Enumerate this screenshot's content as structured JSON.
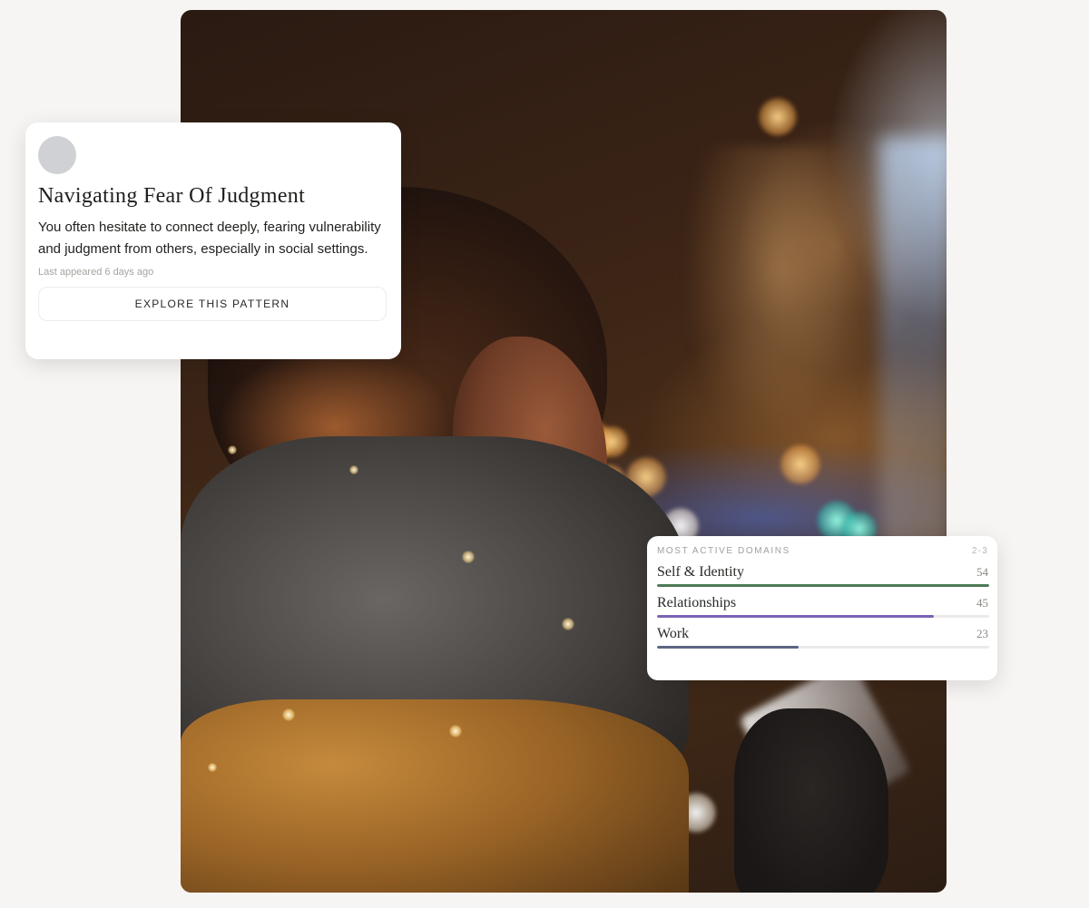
{
  "pattern_card": {
    "title": "Navigating Fear Of Judgment",
    "description": "You often hesitate to connect deeply, fearing vulnerability and judgment from others, especially in social settings.",
    "last_appeared": "Last appeared 6 days ago",
    "explore_label": "EXPLORE THIS PATTERN"
  },
  "domains_card": {
    "title": "MOST ACTIVE DOMAINS",
    "range": "2-3",
    "items": [
      {
        "label": "Self & Identity",
        "count": "54",
        "fill": 1.0,
        "color": "#4e7a56"
      },
      {
        "label": "Relationships",
        "count": "45",
        "fill": 0.833,
        "color": "#7a62b4"
      },
      {
        "label": "Work",
        "count": "23",
        "fill": 0.426,
        "color": "#5c6583"
      }
    ]
  }
}
